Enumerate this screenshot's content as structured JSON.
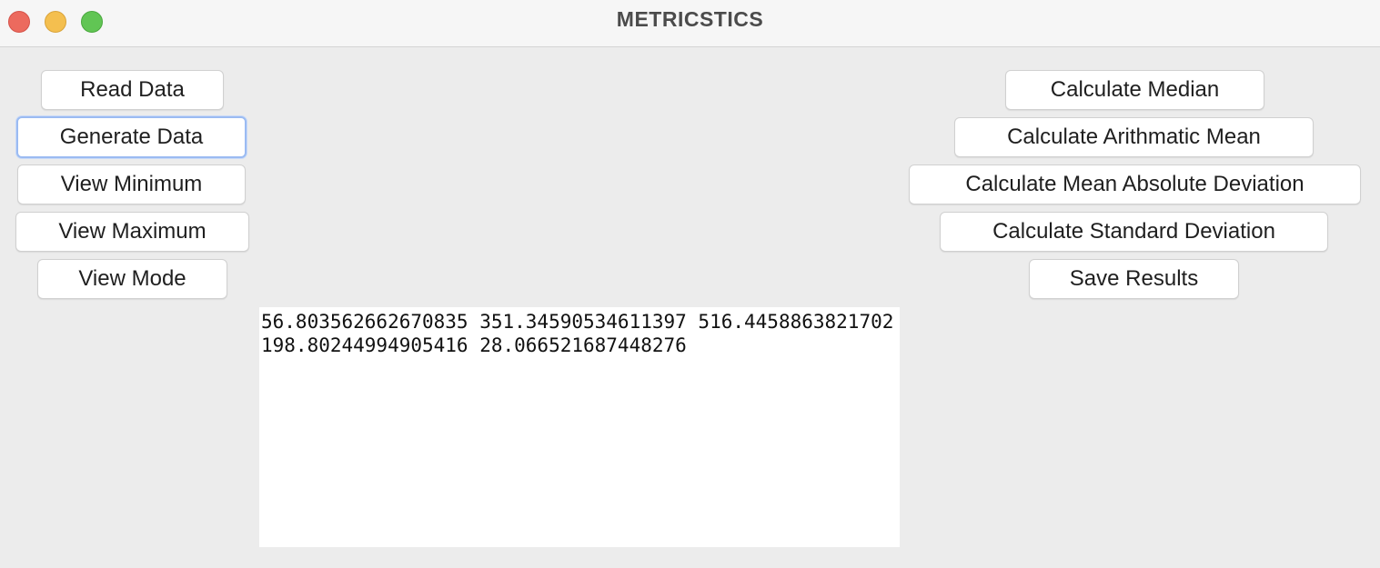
{
  "window": {
    "title": "METRICSTICS"
  },
  "left_buttons": {
    "read_data": "Read Data",
    "generate_data": "Generate Data",
    "view_minimum": "View Minimum",
    "view_maximum": "View Maximum",
    "view_mode": "View Mode"
  },
  "right_buttons": {
    "calculate_median": "Calculate Median",
    "calculate_arithmetic_mean": "Calculate Arithmatic Mean",
    "calculate_mean_absolute_deviation": "Calculate Mean Absolute Deviation",
    "calculate_standard_deviation": "Calculate Standard Deviation",
    "save_results": "Save Results"
  },
  "output": {
    "text": "56.803562662670835 351.34590534611397 516.4458863821702 198.80244994905416 28.066521687448276"
  },
  "colors": {
    "close": "#ec6a5e",
    "minimize": "#f4bf4f",
    "maximize": "#61c554",
    "focus_ring": "#9bbbf2"
  }
}
